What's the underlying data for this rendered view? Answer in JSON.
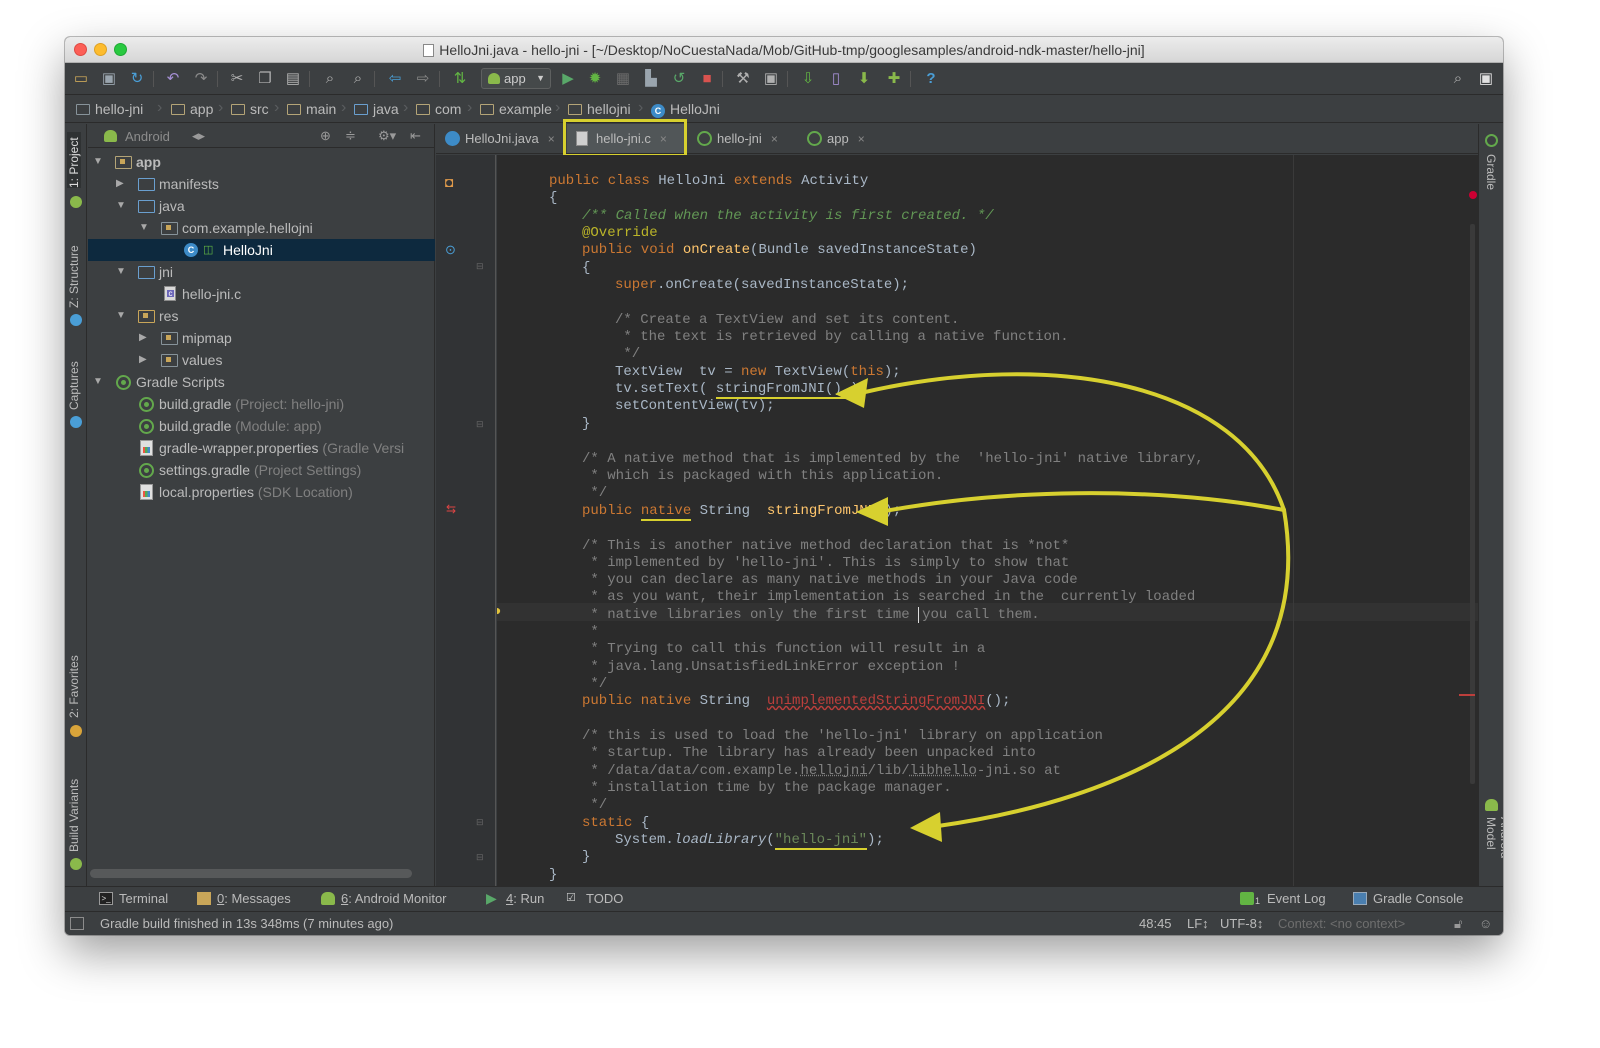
{
  "window": {
    "title": "HelloJni.java - hello-jni - [~/Desktop/NoCuestaNada/Mob/GitHub-tmp/googlesamples/android-ndk-master/hello-jni]"
  },
  "toolbar": {
    "run_config": "app",
    "icons": [
      "open-icon",
      "save-icon",
      "sync-icon",
      "undo-icon",
      "redo-icon",
      "cut-icon",
      "copy-icon",
      "paste-icon",
      "find-icon",
      "replace-icon",
      "back-icon",
      "forward-icon",
      "make-icon",
      "run-icon",
      "debug-icon",
      "attach-debugger-icon",
      "stop-icon",
      "project-structure-icon",
      "sdk-manager-icon",
      "avd-manager-icon",
      "android-device-monitor-icon",
      "help-icon",
      "search-everywhere-icon"
    ]
  },
  "breadcrumbs": [
    "hello-jni",
    "app",
    "src",
    "main",
    "java",
    "com",
    "example",
    "hellojni",
    "HelloJni"
  ],
  "left_tool_tabs": [
    "1: Project",
    "Z: Structure",
    "Captures",
    "2: Favorites",
    "Build Variants"
  ],
  "right_tool_tabs": [
    "Gradle",
    "Android Model"
  ],
  "project_panel": {
    "view": "Android",
    "tree": [
      {
        "label": "app",
        "hint": ""
      },
      {
        "label": "manifests",
        "hint": ""
      },
      {
        "label": "java",
        "hint": ""
      },
      {
        "label": "com.example.hellojni",
        "hint": ""
      },
      {
        "label": "HelloJni",
        "hint": ""
      },
      {
        "label": "jni",
        "hint": ""
      },
      {
        "label": "hello-jni.c",
        "hint": ""
      },
      {
        "label": "res",
        "hint": ""
      },
      {
        "label": "mipmap",
        "hint": ""
      },
      {
        "label": "values",
        "hint": ""
      },
      {
        "label": "Gradle Scripts",
        "hint": ""
      },
      {
        "label": "build.gradle",
        "hint": "(Project: hello-jni)"
      },
      {
        "label": "build.gradle",
        "hint": "(Module: app)"
      },
      {
        "label": "gradle-wrapper.properties",
        "hint": "(Gradle Versi"
      },
      {
        "label": "settings.gradle",
        "hint": "(Project Settings)"
      },
      {
        "label": "local.properties",
        "hint": "(SDK Location)"
      }
    ]
  },
  "editor_tabs": [
    {
      "label": "HelloJni.java",
      "close": "×"
    },
    {
      "label": "hello-jni.c",
      "close": "×"
    },
    {
      "label": "hello-jni",
      "close": "×"
    },
    {
      "label": "app",
      "close": "×"
    }
  ],
  "code": {
    "l1a": "public class ",
    "l1b": "HelloJni ",
    "l1c": "extends ",
    "l1d": "Activity",
    "l2": "{",
    "l3": "/** Called when the activity is first created. */",
    "l4": "@Override",
    "l5a": "public void ",
    "l5b": "onCreate",
    "l5c": "(Bundle savedInstanceState)",
    "l6": "{",
    "l7a": "super",
    "l7b": ".onCreate(savedInstanceState);",
    "l8": "/* Create a TextView and set its content.",
    "l9": " * the text is retrieved by calling a native function.",
    "l10": " */",
    "l11a": "TextView  tv = ",
    "l11b": "new ",
    "l11c": "TextView(",
    "l11d": "this",
    "l11e": ");",
    "l12a": "tv.setText( ",
    "l12b": "stringFromJNI() ",
    "l12c": ");",
    "l13": "setContentView(tv);",
    "l14": "}",
    "l15": "/* A native method that is implemented by the  'hello-jni' native library,",
    "l16": " * which is packaged with this application.",
    "l17": " */",
    "l18a": "public ",
    "l18b": "native",
    "l18c": " String  ",
    "l18d": "stringFromJNI",
    "l18e": "();",
    "l19": "/* This is another native method declaration that is *not*",
    "l20": " * implemented by 'hello-jni'. This is simply to show that",
    "l21": " * you can declare as many native methods in your Java code",
    "l22": " * as you want, their implementation is searched in the  currently loaded",
    "l23": " * native libraries only the first time ",
    "l23b": "you call them.",
    "l24": " *",
    "l25": " * Trying to call this function will result in a",
    "l26": " * java.lang.UnsatisfiedLinkError exception !",
    "l27": " */",
    "l28a": "public native ",
    "l28b": "String  ",
    "l28c": "unimplementedStringFromJNI",
    "l28d": "();",
    "l29": "/* this is used to load the 'hello-jni' library on application",
    "l30": " * startup. The library has already been unpacked into",
    "l31a": " * /data/data/com.example.",
    "l31b": "hellojni",
    "l31c": "/lib/",
    "l31d": "libhello",
    "l31e": "-jni.so at",
    "l32": " * installation time by the package manager.",
    "l33": " */",
    "l34a": "static ",
    "l34b": "{",
    "l35a": "System.",
    "l35b": "loadLibrary",
    "l35c": "(",
    "l35d": "\"hello-jni\"",
    "l35e": ");",
    "l36": "}",
    "l37": "}"
  },
  "bottom_tools": {
    "terminal": "Terminal",
    "messages_num": "0",
    "messages": ": Messages",
    "monitor_num": "6",
    "monitor": ": Android Monitor",
    "run_num": "4",
    "run": ": Run",
    "todo": "TODO",
    "event_log": "Event Log",
    "event_log_badge": "1",
    "gradle_console": "Gradle Console"
  },
  "status": {
    "message": "Gradle build finished in 13s 348ms (7 minutes ago)",
    "position": "48:45",
    "line_sep": "LF↕",
    "encoding": "UTF-8↕",
    "context": "Context: <no context>"
  },
  "colors": {
    "annotation_highlight": "#d7d02f",
    "keyword": "#cc7832",
    "doc_comment": "#629755",
    "function": "#ffc66d"
  }
}
